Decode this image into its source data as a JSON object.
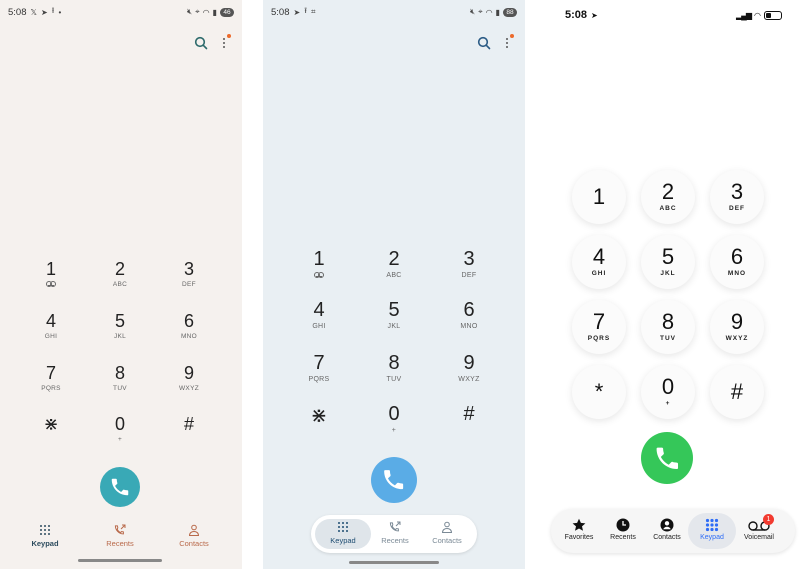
{
  "panels": [
    {
      "status": {
        "time": "5:08",
        "battery": "46"
      },
      "keys": [
        {
          "digit": "1",
          "letters": ""
        },
        {
          "digit": "2",
          "letters": "ABC"
        },
        {
          "digit": "3",
          "letters": "DEF"
        },
        {
          "digit": "4",
          "letters": "GHI"
        },
        {
          "digit": "5",
          "letters": "JKL"
        },
        {
          "digit": "6",
          "letters": "MNO"
        },
        {
          "digit": "7",
          "letters": "PQRS"
        },
        {
          "digit": "8",
          "letters": "TUV"
        },
        {
          "digit": "9",
          "letters": "WXYZ"
        },
        {
          "digit": "*",
          "letters": ""
        },
        {
          "digit": "0",
          "letters": "+"
        },
        {
          "digit": "#",
          "letters": ""
        }
      ],
      "nav": [
        {
          "label": "Keypad",
          "active": true
        },
        {
          "label": "Recents",
          "active": false
        },
        {
          "label": "Contacts",
          "active": false
        }
      ],
      "colors": {
        "accent": "#39a9b6",
        "nav_active": "#2d4c5e",
        "nav_inactive": "#b96a4b"
      }
    },
    {
      "status": {
        "time": "5:08",
        "battery": "88"
      },
      "keys": [
        {
          "digit": "1",
          "letters": ""
        },
        {
          "digit": "2",
          "letters": "ABC"
        },
        {
          "digit": "3",
          "letters": "DEF"
        },
        {
          "digit": "4",
          "letters": "GHI"
        },
        {
          "digit": "5",
          "letters": "JKL"
        },
        {
          "digit": "6",
          "letters": "MNO"
        },
        {
          "digit": "7",
          "letters": "PQRS"
        },
        {
          "digit": "8",
          "letters": "TUV"
        },
        {
          "digit": "9",
          "letters": "WXYZ"
        },
        {
          "digit": "*",
          "letters": ""
        },
        {
          "digit": "0",
          "letters": "+"
        },
        {
          "digit": "#",
          "letters": ""
        }
      ],
      "nav": [
        {
          "label": "Keypad",
          "active": true
        },
        {
          "label": "Recents",
          "active": false
        },
        {
          "label": "Contacts",
          "active": false
        }
      ],
      "colors": {
        "accent": "#5aace6",
        "nav_active": "#1f4d72",
        "nav_inactive": "#7b8a96"
      }
    },
    {
      "status": {
        "time": "5:08"
      },
      "keys": [
        {
          "digit": "1",
          "letters": ""
        },
        {
          "digit": "2",
          "letters": "ABC"
        },
        {
          "digit": "3",
          "letters": "DEF"
        },
        {
          "digit": "4",
          "letters": "GHI"
        },
        {
          "digit": "5",
          "letters": "JKL"
        },
        {
          "digit": "6",
          "letters": "MNO"
        },
        {
          "digit": "7",
          "letters": "PQRS"
        },
        {
          "digit": "8",
          "letters": "TUV"
        },
        {
          "digit": "9",
          "letters": "WXYZ"
        },
        {
          "digit": "*",
          "letters": ""
        },
        {
          "digit": "0",
          "letters": "+"
        },
        {
          "digit": "#",
          "letters": ""
        }
      ],
      "nav": [
        {
          "label": "Favorites",
          "active": false
        },
        {
          "label": "Recents",
          "active": false
        },
        {
          "label": "Contacts",
          "active": false
        },
        {
          "label": "Keypad",
          "active": true
        },
        {
          "label": "Voicemail",
          "active": false,
          "badge": "1"
        }
      ],
      "colors": {
        "accent": "#35c759",
        "nav_active": "#2f6df6",
        "nav_inactive": "#222222"
      }
    }
  ]
}
